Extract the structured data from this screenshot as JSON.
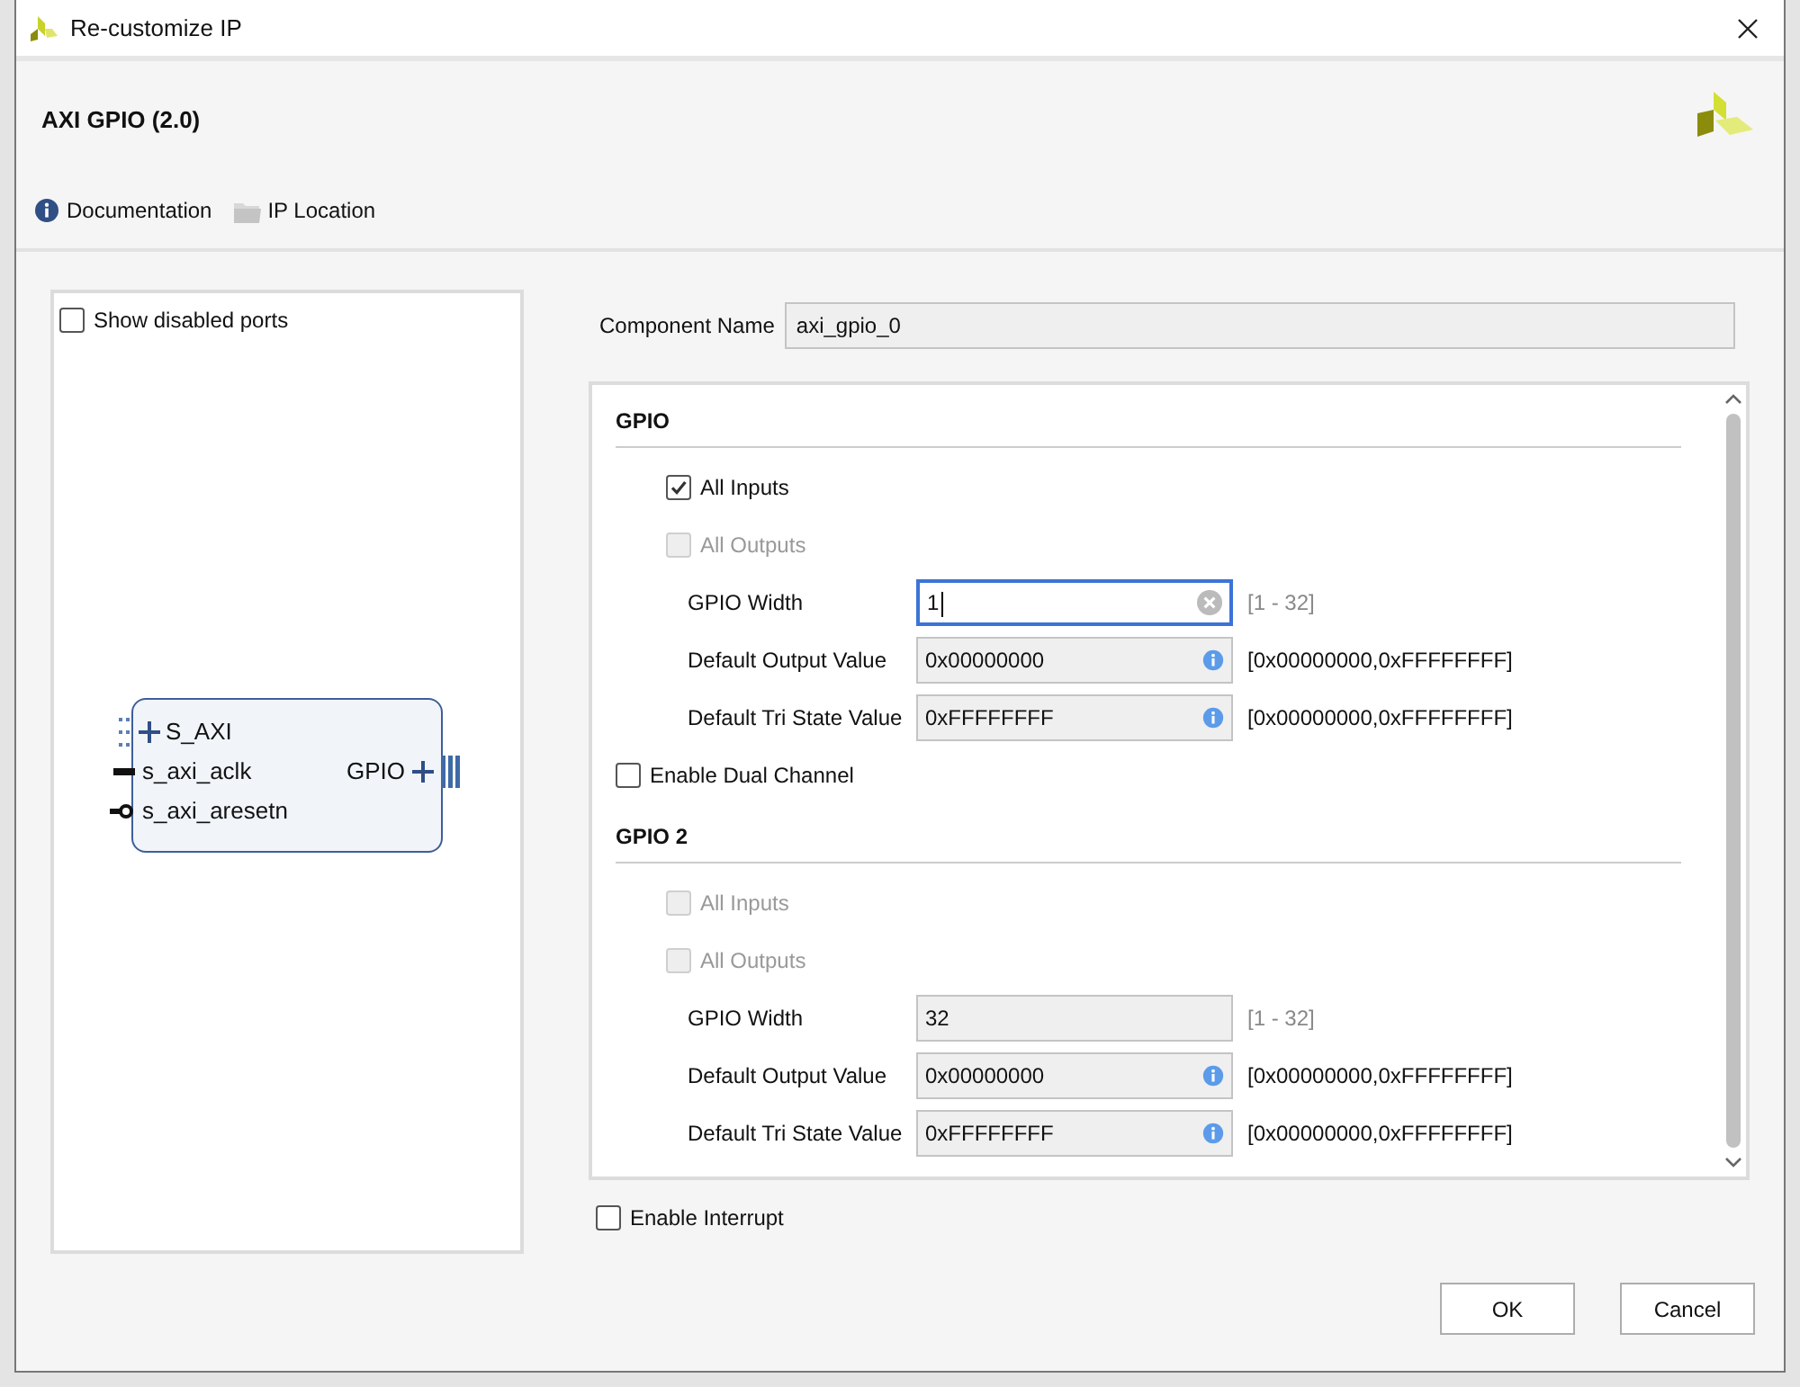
{
  "window": {
    "title": "Re-customize IP"
  },
  "header": {
    "title": "AXI GPIO (2.0)"
  },
  "links": [
    {
      "kind": "info",
      "label": "Documentation"
    },
    {
      "kind": "folder",
      "label": "IP Location"
    }
  ],
  "show_disabled_ports": {
    "label": "Show disabled ports",
    "checked": false
  },
  "block": {
    "left_ports": [
      {
        "kind": "bus",
        "name": "S_AXI"
      },
      {
        "kind": "clock",
        "name": "s_axi_aclk"
      },
      {
        "kind": "reset",
        "name": "s_axi_aresetn"
      }
    ],
    "right_ports": [
      {
        "kind": "bus",
        "name": "GPIO"
      }
    ]
  },
  "component_name": {
    "label": "Component Name",
    "value": "axi_gpio_0"
  },
  "panel_items": [
    {
      "kind": "section",
      "label": "GPIO"
    },
    {
      "kind": "checkbox",
      "label": "All Inputs",
      "checked": true,
      "disabled": false
    },
    {
      "kind": "checkbox",
      "label": "All Outputs",
      "checked": false,
      "disabled": true
    },
    {
      "kind": "field",
      "label": "GPIO Width",
      "value": "1",
      "focused": true,
      "editable": true,
      "info": false,
      "range": "[1 - 32]",
      "range_muted": true
    },
    {
      "kind": "field",
      "label": "Default Output Value",
      "value": "0x00000000",
      "focused": false,
      "editable": false,
      "info": true,
      "range": "[0x00000000,0xFFFFFFFF]",
      "range_muted": false
    },
    {
      "kind": "field",
      "label": "Default Tri State Value",
      "value": "0xFFFFFFFF",
      "focused": false,
      "editable": false,
      "info": true,
      "range": "[0x00000000,0xFFFFFFFF]",
      "range_muted": false
    },
    {
      "kind": "option",
      "label": "Enable Dual Channel",
      "checked": false
    },
    {
      "kind": "section",
      "label": "GPIO 2"
    },
    {
      "kind": "checkbox",
      "label": "All Inputs",
      "checked": false,
      "disabled": true
    },
    {
      "kind": "checkbox",
      "label": "All Outputs",
      "checked": false,
      "disabled": true
    },
    {
      "kind": "field",
      "label": "GPIO Width",
      "value": "32",
      "focused": false,
      "editable": false,
      "info": false,
      "range": "[1 - 32]",
      "range_muted": true
    },
    {
      "kind": "field",
      "label": "Default Output Value",
      "value": "0x00000000",
      "focused": false,
      "editable": false,
      "info": true,
      "range": "[0x00000000,0xFFFFFFFF]",
      "range_muted": false
    },
    {
      "kind": "field",
      "label": "Default Tri State Value",
      "value": "0xFFFFFFFF",
      "focused": false,
      "editable": false,
      "info": true,
      "range": "[0x00000000,0xFFFFFFFF]",
      "range_muted": false
    }
  ],
  "enable_interrupt": {
    "label": "Enable Interrupt",
    "checked": false
  },
  "buttons": [
    {
      "label": "OK"
    },
    {
      "label": "Cancel"
    }
  ]
}
